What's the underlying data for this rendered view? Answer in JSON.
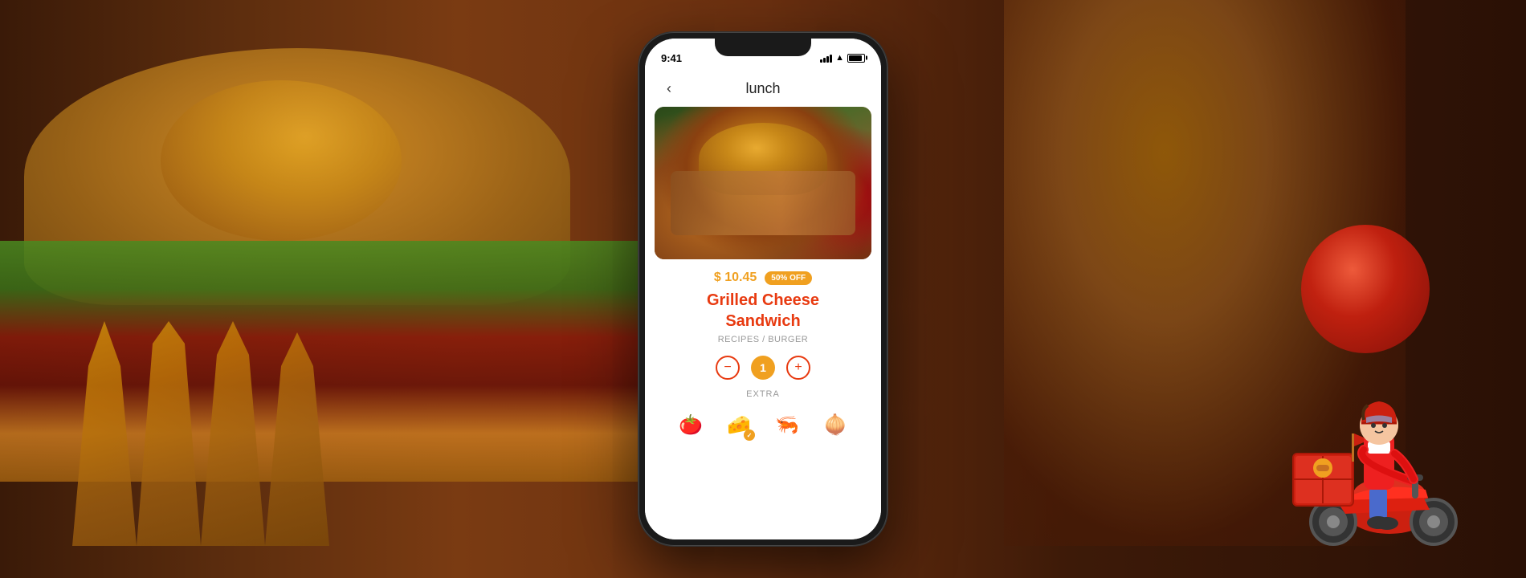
{
  "background": {
    "color": "#3a1a08"
  },
  "status_bar": {
    "time": "9:41",
    "signal": "full",
    "wifi": true,
    "battery": 80
  },
  "header": {
    "back_label": "‹",
    "title": "lunch"
  },
  "food_item": {
    "price": "$ 10.45",
    "discount": "50% OFF",
    "name_line1": "Grilled Cheese",
    "name_line2": "Sandwich",
    "category": "RECIPES / BURGER",
    "quantity": "1",
    "extra_label": "EXTRA"
  },
  "extras": [
    {
      "emoji": "🍅",
      "label": "tomato",
      "checked": false
    },
    {
      "emoji": "🧀",
      "label": "cheese",
      "checked": true
    },
    {
      "emoji": "🦐",
      "label": "shrimp",
      "checked": false
    },
    {
      "emoji": "🧅",
      "label": "onion",
      "checked": false
    }
  ],
  "colors": {
    "primary_orange": "#f0a020",
    "primary_red": "#e83a10",
    "text_dark": "#222222",
    "text_gray": "#999999",
    "white": "#ffffff"
  }
}
